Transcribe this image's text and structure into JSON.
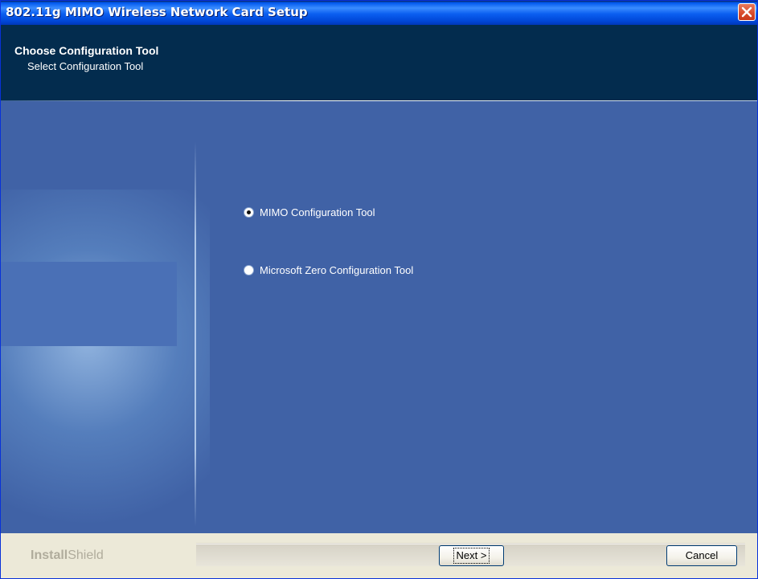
{
  "window": {
    "title": "802.11g MIMO Wireless Network Card Setup"
  },
  "header": {
    "title": "Choose Configuration Tool",
    "subtitle": "Select Configuration Tool"
  },
  "options": [
    {
      "label": "MIMO Configuration Tool",
      "selected": true
    },
    {
      "label": "Microsoft Zero Configuration Tool",
      "selected": false
    }
  ],
  "footer": {
    "brand_bold": "Install",
    "brand_rest": "Shield",
    "next_label": "Next >",
    "cancel_label": "Cancel"
  },
  "colors": {
    "header_bg": "#032c4e",
    "content_bg": "#4062a6",
    "titlebar": "#0058ee",
    "close_button": "#d84a2a"
  },
  "icons": {
    "close": "close-icon",
    "radio_checked": "radio-checked-icon",
    "radio_unchecked": "radio-unchecked-icon"
  }
}
